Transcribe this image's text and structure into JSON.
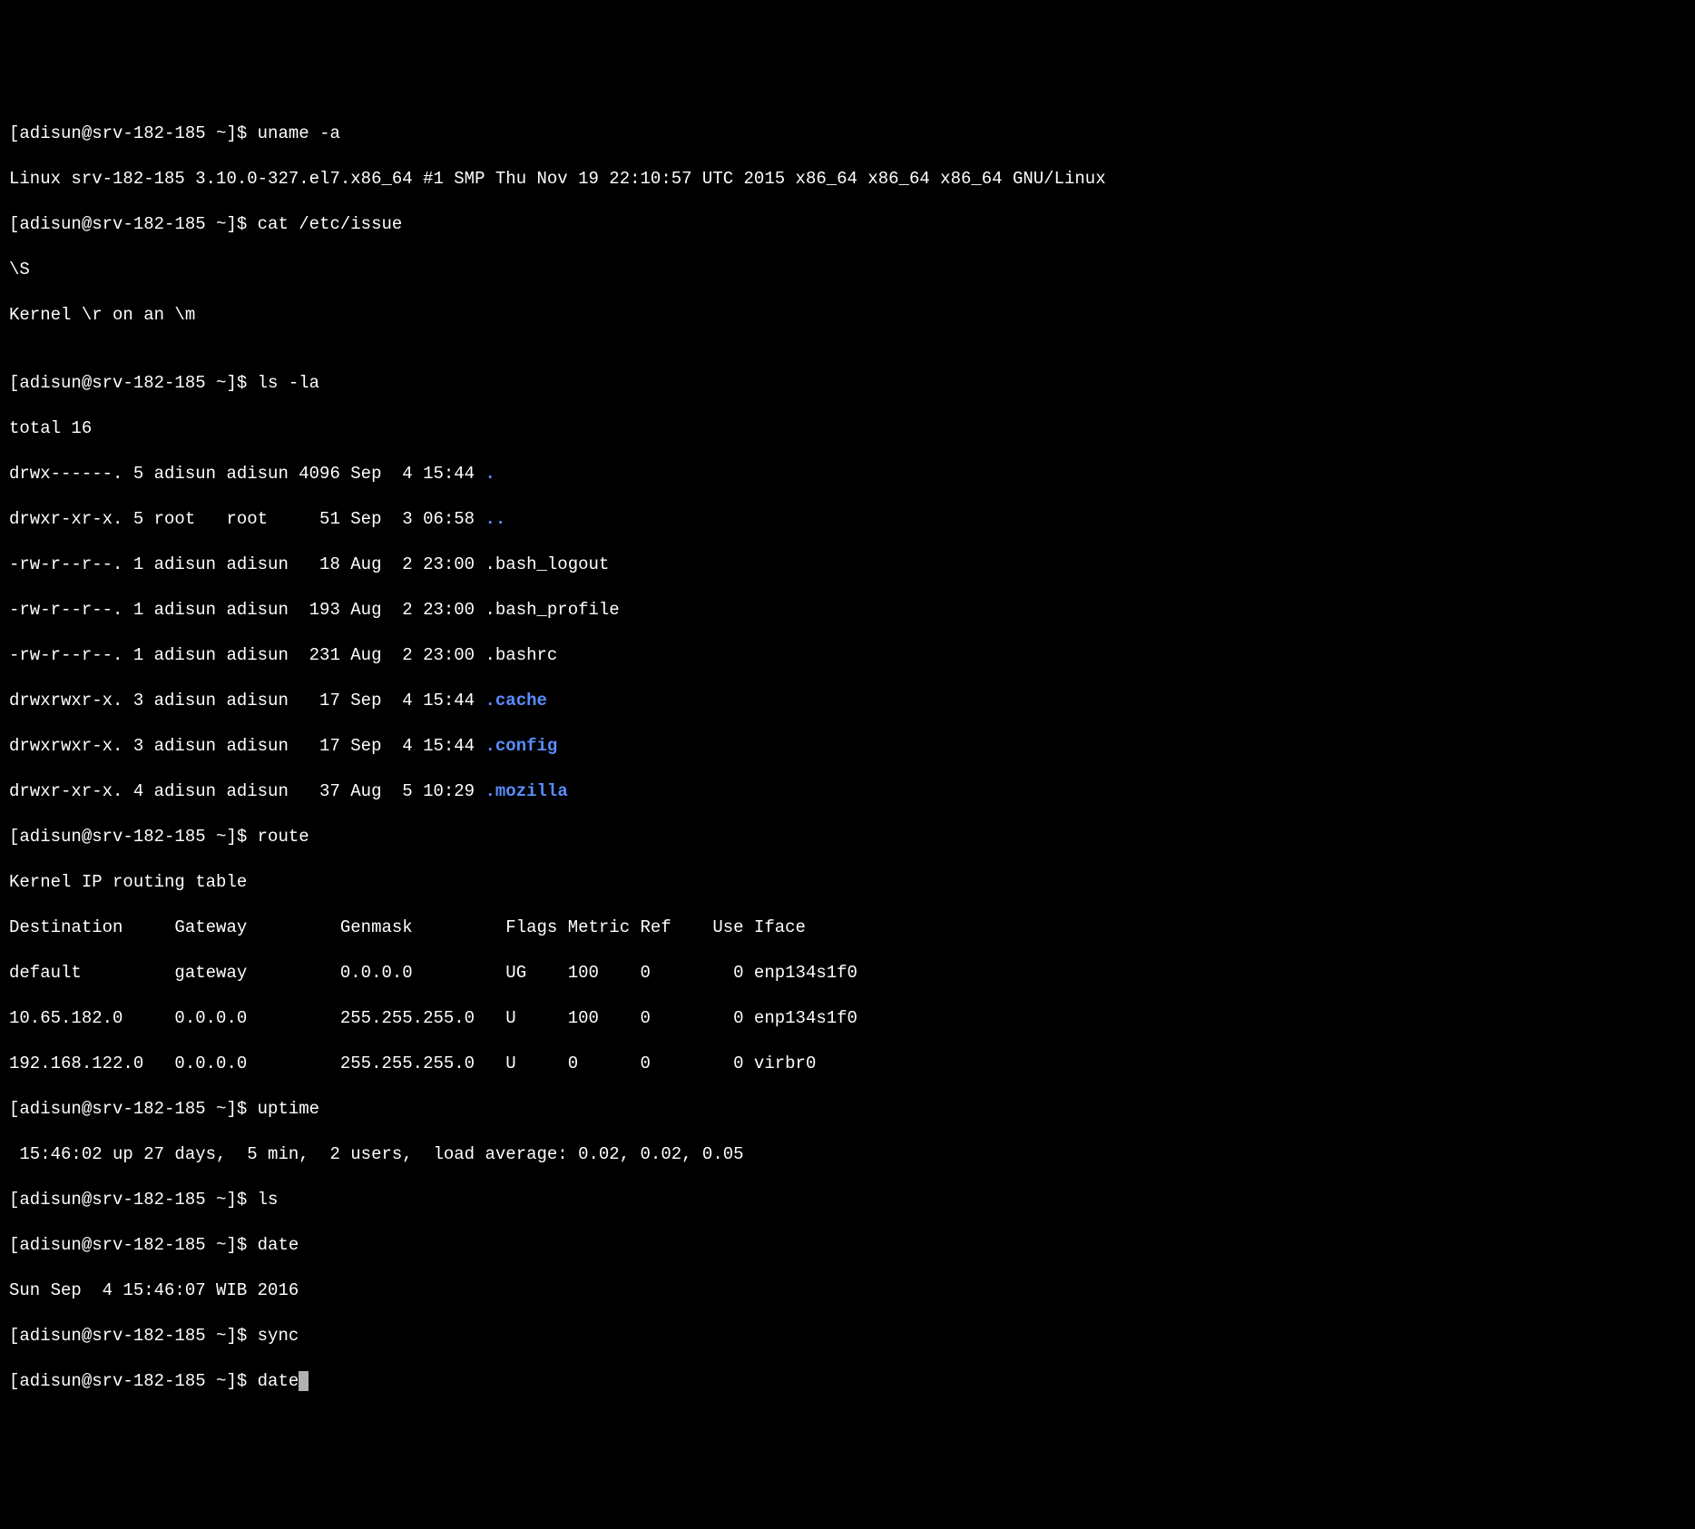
{
  "prompt": "[adisun@srv-182-185 ~]$ ",
  "cmd1": "uname -a",
  "out1": "Linux srv-182-185 3.10.0-327.el7.x86_64 #1 SMP Thu Nov 19 22:10:57 UTC 2015 x86_64 x86_64 x86_64 GNU/Linux",
  "cmd2": "cat /etc/issue",
  "out2_l1": "\\S",
  "out2_l2": "Kernel \\r on an \\m",
  "blank": "",
  "cmd3": "ls -la",
  "ls_total": "total 16",
  "ls_row1_pre": "drwx------. 5 adisun adisun 4096 Sep  4 15:44 ",
  "ls_row1_name": ".",
  "ls_row2_pre": "drwxr-xr-x. 5 root   root     51 Sep  3 06:58 ",
  "ls_row2_name": "..",
  "ls_row3": "-rw-r--r--. 1 adisun adisun   18 Aug  2 23:00 .bash_logout",
  "ls_row4": "-rw-r--r--. 1 adisun adisun  193 Aug  2 23:00 .bash_profile",
  "ls_row5": "-rw-r--r--. 1 adisun adisun  231 Aug  2 23:00 .bashrc",
  "ls_row6_pre": "drwxrwxr-x. 3 adisun adisun   17 Sep  4 15:44 ",
  "ls_row6_name": ".cache",
  "ls_row7_pre": "drwxrwxr-x. 3 adisun adisun   17 Sep  4 15:44 ",
  "ls_row7_name": ".config",
  "ls_row8_pre": "drwxr-xr-x. 4 adisun adisun   37 Aug  5 10:29 ",
  "ls_row8_name": ".mozilla",
  "cmd4": "route",
  "route_title": "Kernel IP routing table",
  "route_hdr": "Destination     Gateway         Genmask         Flags Metric Ref    Use Iface",
  "route_r1": "default         gateway         0.0.0.0         UG    100    0        0 enp134s1f0",
  "route_r2": "10.65.182.0     0.0.0.0         255.255.255.0   U     100    0        0 enp134s1f0",
  "route_r3": "192.168.122.0   0.0.0.0         255.255.255.0   U     0      0        0 virbr0",
  "cmd5": "uptime",
  "uptime_out": " 15:46:02 up 27 days,  5 min,  2 users,  load average: 0.02, 0.02, 0.05",
  "cmd6": "ls",
  "cmd7": "date",
  "date_out": "Sun Sep  4 15:46:07 WIB 2016",
  "cmd8": "sync",
  "cmd9": "date"
}
